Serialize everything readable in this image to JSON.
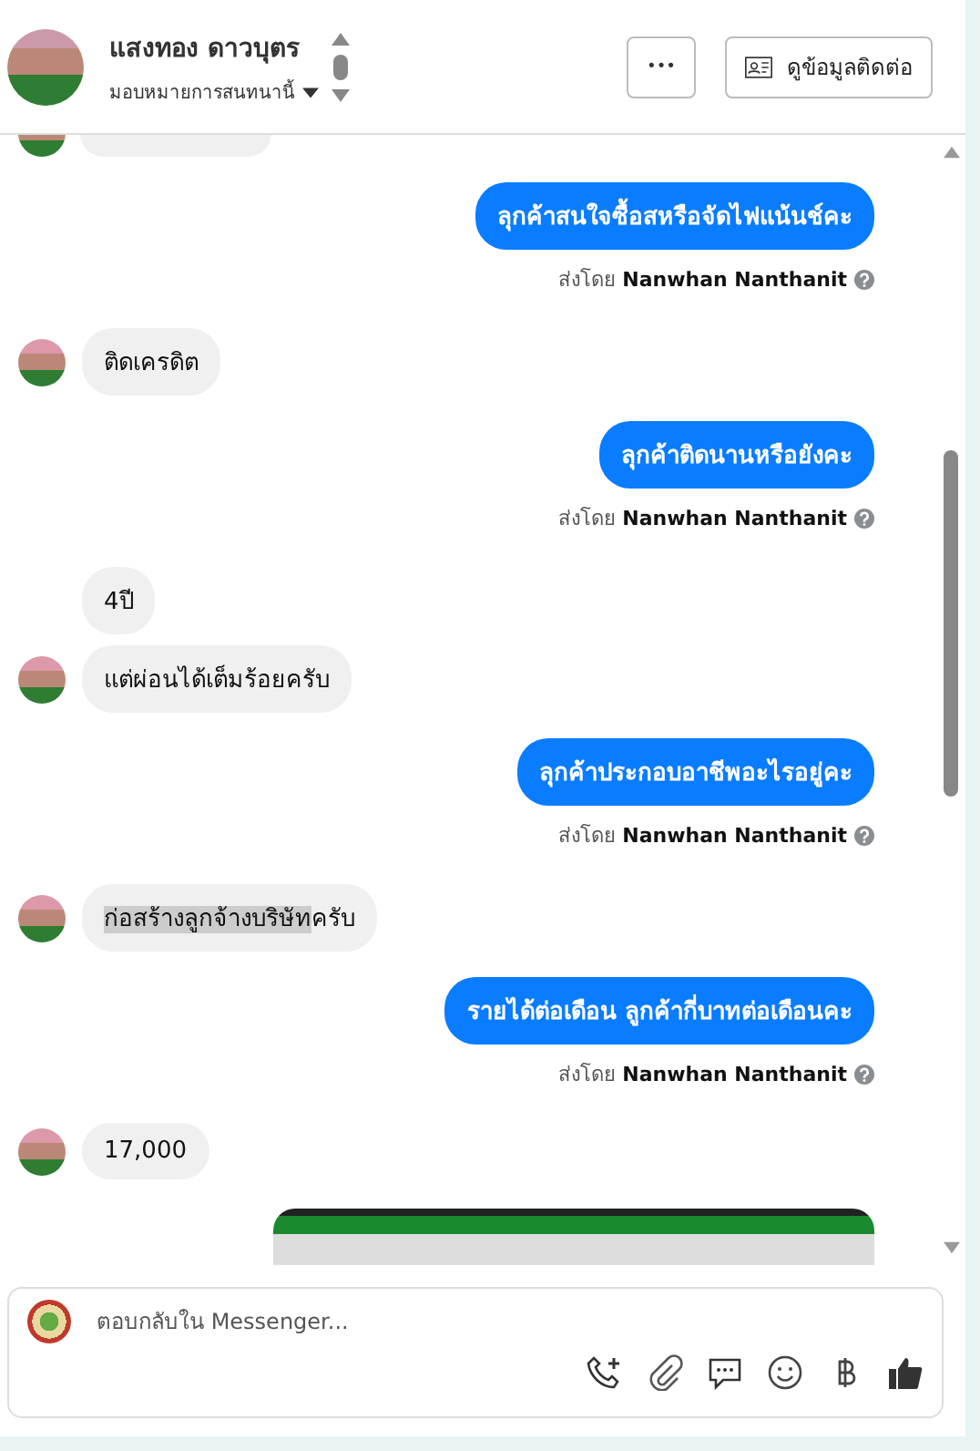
{
  "header": {
    "name": "แสงทอง ดาวบุตร",
    "assign_label": "มอบหมายการสนทนานี้",
    "more_button": "•••",
    "contact_button": "ดูข้อมูลติดต่อ"
  },
  "messages": [
    {
      "kind": "cut"
    },
    {
      "kind": "outgoing",
      "text": "ลุกค้าสนใจซื้อสหรือจัดไฟแน้นช์คะ",
      "sent_by_label": "ส่งโดย",
      "sender": "Nanwhan Nanthanit"
    },
    {
      "kind": "incoming",
      "avatar": true,
      "parts": [
        {
          "text": "ติดเครดิต",
          "selected": false
        }
      ]
    },
    {
      "kind": "outgoing",
      "text": "ลุกค้าติดนานหรือยังคะ",
      "sent_by_label": "ส่งโดย",
      "sender": "Nanwhan Nanthanit"
    },
    {
      "kind": "incoming",
      "avatar": false,
      "parts": [
        {
          "text": "4ปี",
          "selected": false
        }
      ]
    },
    {
      "kind": "incoming",
      "avatar": true,
      "parts": [
        {
          "text": "แต่ผ่อนได้เต็มร้อยครับ",
          "selected": false
        }
      ]
    },
    {
      "kind": "outgoing",
      "text": "ลุกค้าประกอบอาชีพอะไรอยู่คะ",
      "sent_by_label": "ส่งโดย",
      "sender": "Nanwhan Nanthanit"
    },
    {
      "kind": "incoming",
      "avatar": true,
      "parts": [
        {
          "text": "ก่อสร้างลูกจ้างบริษัท",
          "selected": true
        },
        {
          "text": "ครับ",
          "selected": false
        }
      ]
    },
    {
      "kind": "outgoing",
      "text": "รายได้ต่อเดือน ลูกค้ากี่บาทต่อเดือนคะ",
      "sent_by_label": "ส่งโดย",
      "sender": "Nanwhan Nanthanit"
    },
    {
      "kind": "incoming",
      "avatar": true,
      "parts": [
        {
          "text": "17,000",
          "selected": false
        }
      ]
    },
    {
      "kind": "image"
    }
  ],
  "composer": {
    "placeholder": "ตอบกลับใน Messenger..."
  }
}
